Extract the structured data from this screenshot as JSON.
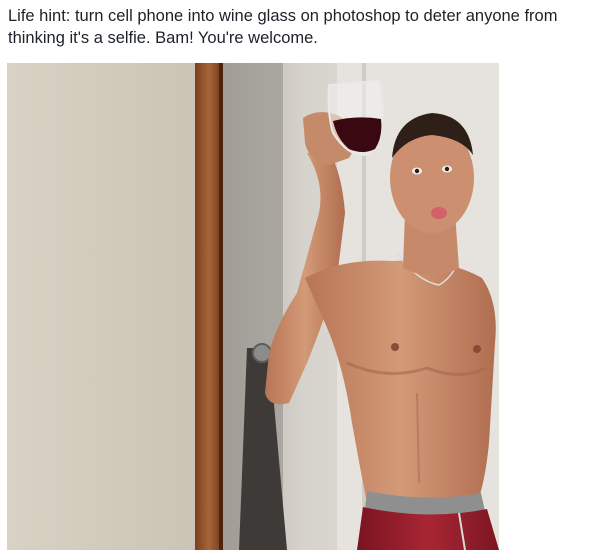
{
  "post": {
    "caption": "Life hint: turn cell phone into wine glass on photoshop to deter anyone from thinking it's a selfie. Bam! You're welcome."
  },
  "photo": {
    "alt": "Shirtless man in front of a mirror holding a wine glass"
  },
  "colors": {
    "text": "#1d2129",
    "wall": "#d8d3cb",
    "door_frame": "#9a5a32",
    "skin": "#c98a68",
    "shorts": "#9a1e2c",
    "wine": "#3a0810"
  }
}
